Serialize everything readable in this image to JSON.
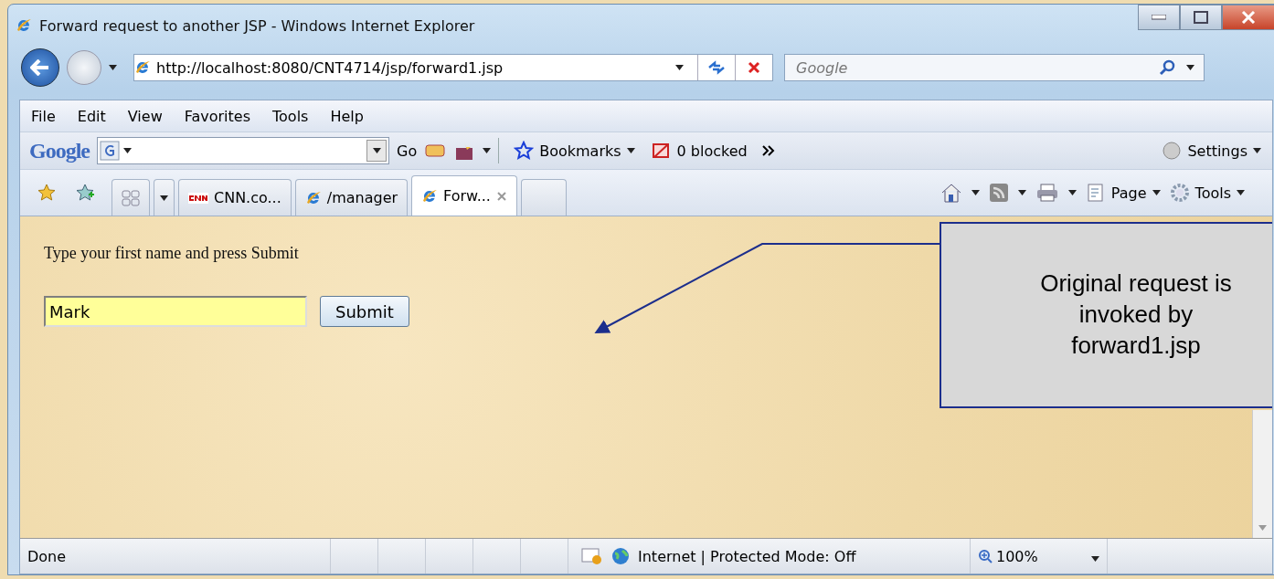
{
  "window": {
    "title": "Forward request to another JSP - Windows Internet Explorer"
  },
  "address_bar": {
    "url": "http://localhost:8080/CNT4714/jsp/forward1.jsp"
  },
  "search_box": {
    "placeholder": "Google"
  },
  "menu": [
    "File",
    "Edit",
    "View",
    "Favorites",
    "Tools",
    "Help"
  ],
  "google_toolbar": {
    "logo": "Google",
    "go": "Go",
    "bookmarks": "Bookmarks",
    "blocked": "0 blocked",
    "settings": "Settings"
  },
  "tabs": [
    {
      "label": "CNN.co...",
      "selected": false,
      "kind": "cnn"
    },
    {
      "label": "/manager",
      "selected": false,
      "kind": "ie"
    },
    {
      "label": "Forw...",
      "selected": true,
      "kind": "ie"
    }
  ],
  "command_bar": {
    "page": "Page",
    "tools": "Tools"
  },
  "page": {
    "prompt": "Type your first name and press Submit",
    "name_field": {
      "value": "Mark"
    },
    "submit": "Submit"
  },
  "callout": {
    "text": "Original request is invoked by forward1.jsp"
  },
  "status_bar": {
    "status": "Done",
    "zone": "Internet | Protected Mode: Off",
    "zoom": "100%"
  }
}
